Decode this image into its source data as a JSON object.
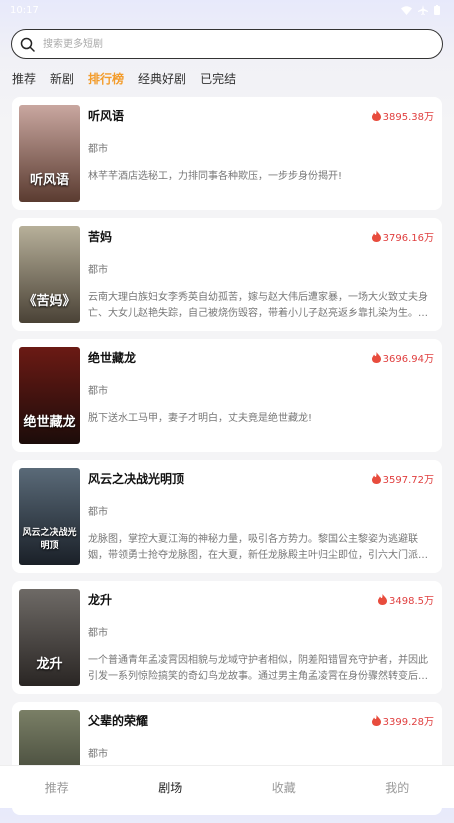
{
  "status_bar": {
    "time": "10:17"
  },
  "search": {
    "placeholder": "搜索更多短剧"
  },
  "tabs": [
    {
      "label": "推荐"
    },
    {
      "label": "新剧"
    },
    {
      "label": "排行榜",
      "active": true
    },
    {
      "label": "经典好剧"
    },
    {
      "label": "已完结"
    }
  ],
  "dramas": [
    {
      "poster_text": "听风语",
      "title": "听风语",
      "heat": "3895.38万",
      "genre": "都市",
      "desc": "林芊芊酒店选秘工，力排同事各种欺压，一步步身份揭开!",
      "poster_colors": [
        "#c9a7a0",
        "#5a3b30"
      ]
    },
    {
      "poster_text": "《苦妈》",
      "title": "苦妈",
      "heat": "3796.16万",
      "genre": "都市",
      "desc": "云南大理白族妇女李秀英自幼孤苦，嫁与赵大伟后遭家暴，一场大火致丈夫身亡、大女儿赵艳失踪，自己被烧伤毁容，带着小儿子赵亮返乡靠扎染为生。…",
      "poster_colors": [
        "#b7b09a",
        "#4a4236"
      ]
    },
    {
      "poster_text": "绝世藏龙",
      "title": "绝世藏龙",
      "heat": "3696.94万",
      "genre": "都市",
      "desc": "脱下送水工马甲，妻子才明白，丈夫竟是绝世藏龙!",
      "poster_colors": [
        "#6b1a14",
        "#1c0c0a"
      ]
    },
    {
      "poster_text": "风云之决战光明顶",
      "title": "风云之决战光明顶",
      "heat": "3597.72万",
      "genre": "都市",
      "desc": "龙脉图，掌控大夏江海的神秘力量，吸引各方势力。黎国公主黎姿为逃避联姻，带领勇士抢夺龙脉图，在大夏，新任龙脉殿主叶归尘即位，引六大门派…",
      "poster_colors": [
        "#5a6a78",
        "#1a2028"
      ]
    },
    {
      "poster_text": "龙升",
      "title": "龙升",
      "heat": "3498.5万",
      "genre": "都市",
      "desc": "一个普通青年孟凌霄因相貌与龙域守护者相似，阴差阳错冒充守护者，并因此引发一系列惊险搞笑的奇幻鸟龙故事。通过男主角孟凌霄在身份骤然转变后…",
      "poster_colors": [
        "#6e6a66",
        "#2a2624"
      ]
    },
    {
      "poster_text": "",
      "title": "父辈的荣耀",
      "heat": "3399.28万",
      "genre": "都市",
      "desc": "",
      "poster_colors": [
        "#7a7f66",
        "#2f3328"
      ]
    }
  ],
  "bottom_nav": [
    {
      "label": "推荐"
    },
    {
      "label": "剧场",
      "active": true
    },
    {
      "label": "收藏"
    },
    {
      "label": "我的"
    }
  ]
}
